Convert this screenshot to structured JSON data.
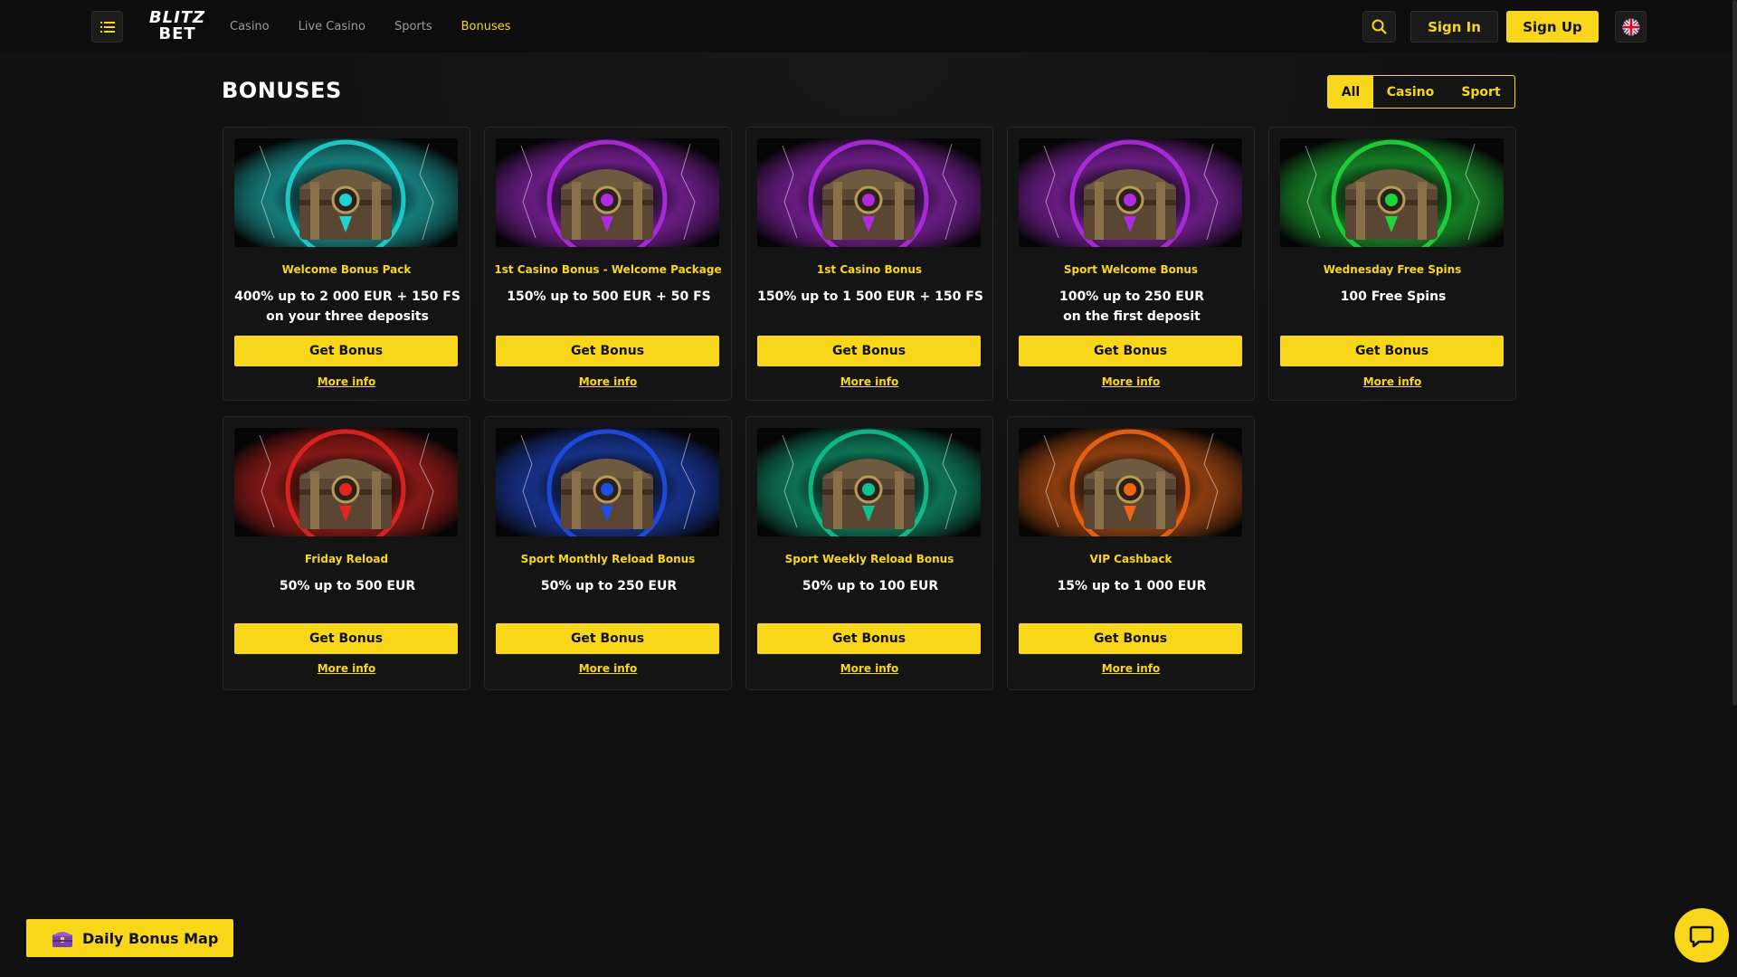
{
  "header": {
    "logo_line1": "BLITZ",
    "logo_line2": "BET",
    "nav": [
      "Casino",
      "Live Casino",
      "Sports",
      "Bonuses"
    ],
    "active_nav": "Bonuses",
    "signin_label": "Sign In",
    "signup_label": "Sign Up",
    "language": "English (UK flag)"
  },
  "page": {
    "title": "BONUSES",
    "filters": [
      "All",
      "Casino",
      "Sport"
    ],
    "active_filter": "All"
  },
  "cards": [
    {
      "title": "Welcome Bonus Pack",
      "desc1": "400% up to 2 000 EUR + 150 FS",
      "desc2": "on your three deposits",
      "button": "Get Bonus",
      "more": "More info",
      "color": "#1fd3d0"
    },
    {
      "title": "1st Casino Bonus - Welcome Package",
      "desc1": "150% up to 500 EUR + 50 FS",
      "desc2": "",
      "button": "Get Bonus",
      "more": "More info",
      "color": "#b02be0"
    },
    {
      "title": "1st Casino Bonus",
      "desc1": "150% up to 1 500 EUR + 150 FS",
      "desc2": "",
      "button": "Get Bonus",
      "more": "More info",
      "color": "#b02be0"
    },
    {
      "title": "Sport Welcome Bonus",
      "desc1": "100% up to 250 EUR",
      "desc2": "on the first deposit",
      "button": "Get Bonus",
      "more": "More info",
      "color": "#b02be0"
    },
    {
      "title": "Wednesday Free Spins",
      "desc1": "100 Free Spins",
      "desc2": "",
      "button": "Get Bonus",
      "more": "More info",
      "color": "#1ed63c"
    },
    {
      "title": "Friday Reload",
      "desc1": "50% up to 500 EUR",
      "desc2": "",
      "button": "Get Bonus",
      "more": "More info",
      "color": "#e4241f"
    },
    {
      "title": "Sport Monthly Reload Bonus",
      "desc1": "50% up to 250 EUR",
      "desc2": "",
      "button": "Get Bonus",
      "more": "More info",
      "color": "#1f4ee6"
    },
    {
      "title": "Sport Weekly Reload Bonus",
      "desc1": "50% up to 100 EUR",
      "desc2": "",
      "button": "Get Bonus",
      "more": "More info",
      "color": "#10c28e"
    },
    {
      "title": "VIP Cashback",
      "desc1": "15% up to 1 000 EUR",
      "desc2": "",
      "button": "Get Bonus",
      "more": "More info",
      "color": "#f06514"
    }
  ],
  "widgets": {
    "daily_bonus_label": "Daily Bonus Map",
    "chat_icon": "chat-bubble-icon"
  },
  "colors": {
    "accent": "#f8d71a",
    "background": "#101010",
    "card_bg": "#141414"
  }
}
